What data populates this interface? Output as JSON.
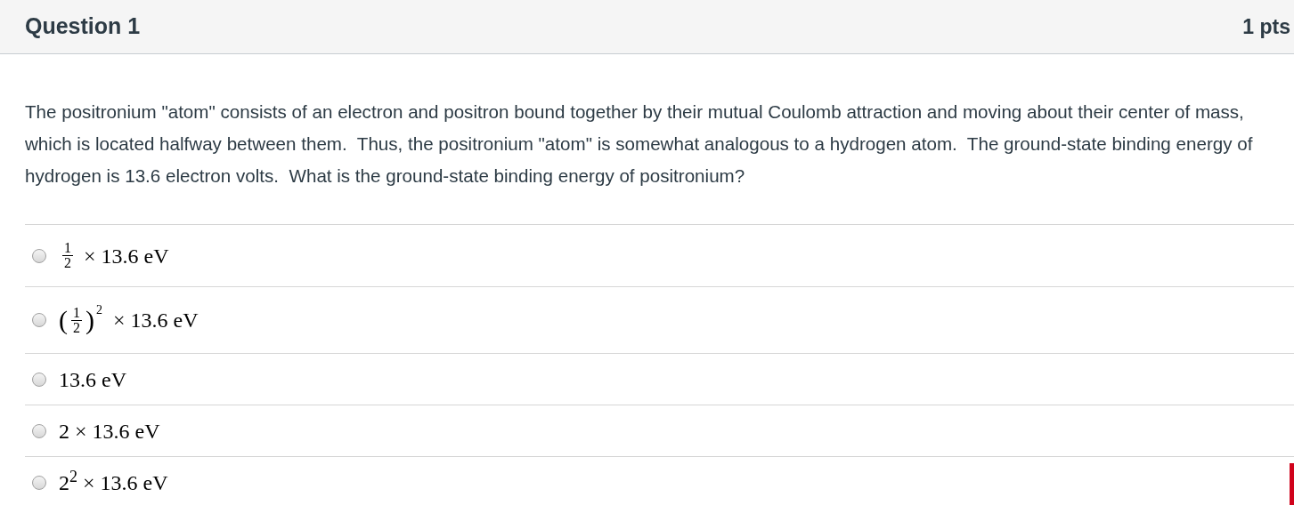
{
  "question": {
    "title": "Question 1",
    "points": "1 pts",
    "text": "The positronium \"atom\" consists of an electron and positron bound together by their mutual Coulomb attraction and moving about their center of mass, which is located halfway between them.  Thus, the positronium \"atom\" is somewhat analogous to a hydrogen atom.  The ground-state binding energy of hydrogen is 13.6 electron volts.  What is the ground-state binding energy of positronium?"
  },
  "answers": [
    {
      "kind": "fraction",
      "numerator": "1",
      "denominator": "2",
      "rest": "× 13.6 eV",
      "selected": false
    },
    {
      "kind": "paren-fraction",
      "open": "(",
      "close": ")",
      "numerator": "1",
      "denominator": "2",
      "exponent": "2",
      "rest": "× 13.6 eV",
      "selected": false
    },
    {
      "kind": "plain",
      "text": "13.6 eV",
      "selected": false
    },
    {
      "kind": "plain",
      "text": "2 × 13.6 eV",
      "selected": false
    },
    {
      "kind": "plain",
      "text": "2$^{2}$ × 13.6 eV",
      "selected": false
    }
  ]
}
